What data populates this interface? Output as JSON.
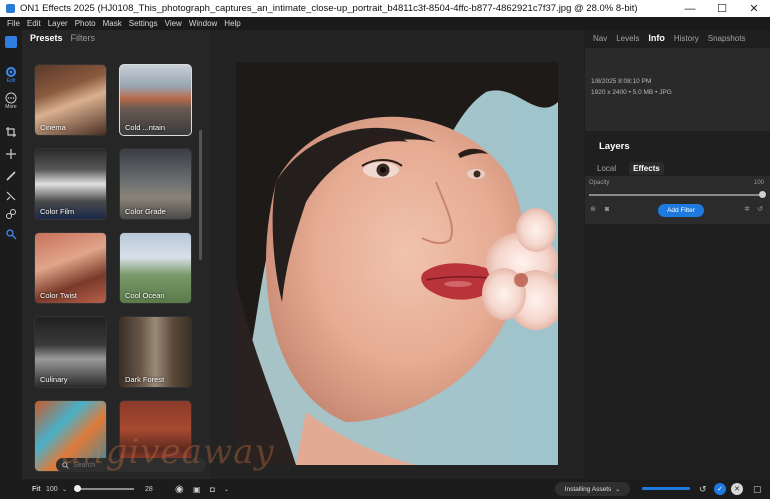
{
  "window": {
    "title": "ON1 Effects 2025 (HJ0108_This_photograph_captures_an_intimate_close-up_portrait_b4811c3f-8504-4ffc-b877-4862921c7f37.jpg @ 28.0% 8-bit)",
    "minimize": "—",
    "maximize": "☐",
    "close": "✕"
  },
  "menu": [
    "File",
    "Edit",
    "Layer",
    "Photo",
    "Mask",
    "Settings",
    "View",
    "Window",
    "Help"
  ],
  "rail": {
    "edit_label": "Edit",
    "more_label": "More"
  },
  "presets_panel": {
    "tabs": [
      "Presets",
      "Filters"
    ],
    "tiles": [
      {
        "label": "Cinema"
      },
      {
        "label": "Cold ...ntain"
      },
      {
        "label": "Color Film"
      },
      {
        "label": "Color Grade"
      },
      {
        "label": "Color Twist"
      },
      {
        "label": "Cool Ocean"
      },
      {
        "label": "Culinary"
      },
      {
        "label": "Dark Forest"
      },
      {
        "label": ""
      },
      {
        "label": ""
      }
    ],
    "search_placeholder": "Search"
  },
  "right_panel": {
    "tabs": [
      "Nav",
      "Levels",
      "Info",
      "History",
      "Snapshots"
    ],
    "info": {
      "date": "1/8/2025 8:08:10 PM",
      "details": "1920 x 2400 • 5.0 MB • JPG"
    },
    "layers_title": "Layers",
    "layer_tabs": [
      "Local",
      "Effects"
    ],
    "opacity_label": "Opacity",
    "opacity_value": "100",
    "add_filter": "Add Filter"
  },
  "bottom": {
    "fit_label": "Fit",
    "zoom_value": "100",
    "slider_value": "28",
    "installing": "Installing Assets"
  },
  "watermark": "uhgiveaway",
  "colors": {
    "accent": "#1f7ae0",
    "panel": "#262626",
    "background": "#1e1e1e"
  }
}
